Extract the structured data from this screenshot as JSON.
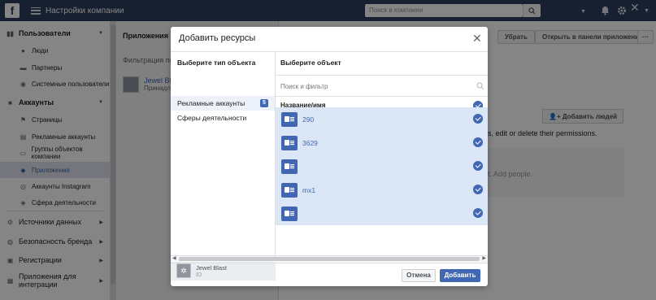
{
  "topbar": {
    "logo": "f",
    "title": "Настройки компании",
    "search_placeholder": "Поиск в компании",
    "icons": [
      "menu-icon",
      "search-icon",
      "dropdown-icon",
      "bell-icon",
      "gear-icon",
      "help-icon"
    ]
  },
  "sidebar": {
    "users": {
      "label": "Пользователи",
      "items": [
        {
          "label": "Люди",
          "icon": "person-icon"
        },
        {
          "label": "Партнеры",
          "icon": "briefcase-icon"
        },
        {
          "label": "Системные пользователи",
          "icon": "system-user-icon"
        }
      ]
    },
    "accounts": {
      "label": "Аккаунты",
      "items": [
        {
          "label": "Страницы",
          "icon": "flag-icon"
        },
        {
          "label": "Рекламные аккаунты",
          "icon": "ad-account-icon"
        },
        {
          "label": "Группы объектов компании",
          "icon": "folder-icon"
        },
        {
          "label": "Приложения",
          "icon": "cube-icon",
          "active": true
        },
        {
          "label": "Аккаунты Instagram",
          "icon": "instagram-icon"
        },
        {
          "label": "Сфера деятельности",
          "icon": "tag-icon"
        }
      ]
    },
    "data_sources": "Источники данных",
    "brand_safety": "Безопасность бренда",
    "registrations": "Регистрации",
    "integrations": "Приложения для интеграции"
  },
  "main": {
    "header": "Приложения",
    "filter": "Фильтрация по",
    "app_name": "Jewel Blast",
    "app_owner": "Принадл",
    "remove_button": "Убрать",
    "open_in_panel_button": "Открыть в панели приложений",
    "more_button": "···",
    "add_people_button": "Добавить людей",
    "permissions_text": "s, edit or delete their permissions.",
    "add_people_hint": "t. Add people."
  },
  "modal": {
    "title": "Добавить ресурсы",
    "left_header": "Выберите тип объекта",
    "types": [
      {
        "label": "Рекламные аккаунты",
        "count": "5",
        "selected": true
      },
      {
        "label": "Сферы деятельности",
        "count": "",
        "selected": false
      }
    ],
    "app_card": {
      "name": "Jewel Blast",
      "sub": "ID"
    },
    "right_header": "Выберите объект",
    "filter_placeholder": "Поиск и фильтр",
    "column_header": "Название/имя",
    "objects": [
      {
        "label": "290",
        "checked": true
      },
      {
        "label": "3629",
        "checked": true
      },
      {
        "label": "",
        "checked": true
      },
      {
        "label": "mx1",
        "checked": true
      },
      {
        "label": "",
        "checked": true
      }
    ],
    "cancel_button": "Отмена",
    "add_button": "Добавить"
  },
  "colors": {
    "accent": "#4267b2",
    "topbar": "#2d3e5e",
    "selected_row": "#dbe7f7"
  }
}
